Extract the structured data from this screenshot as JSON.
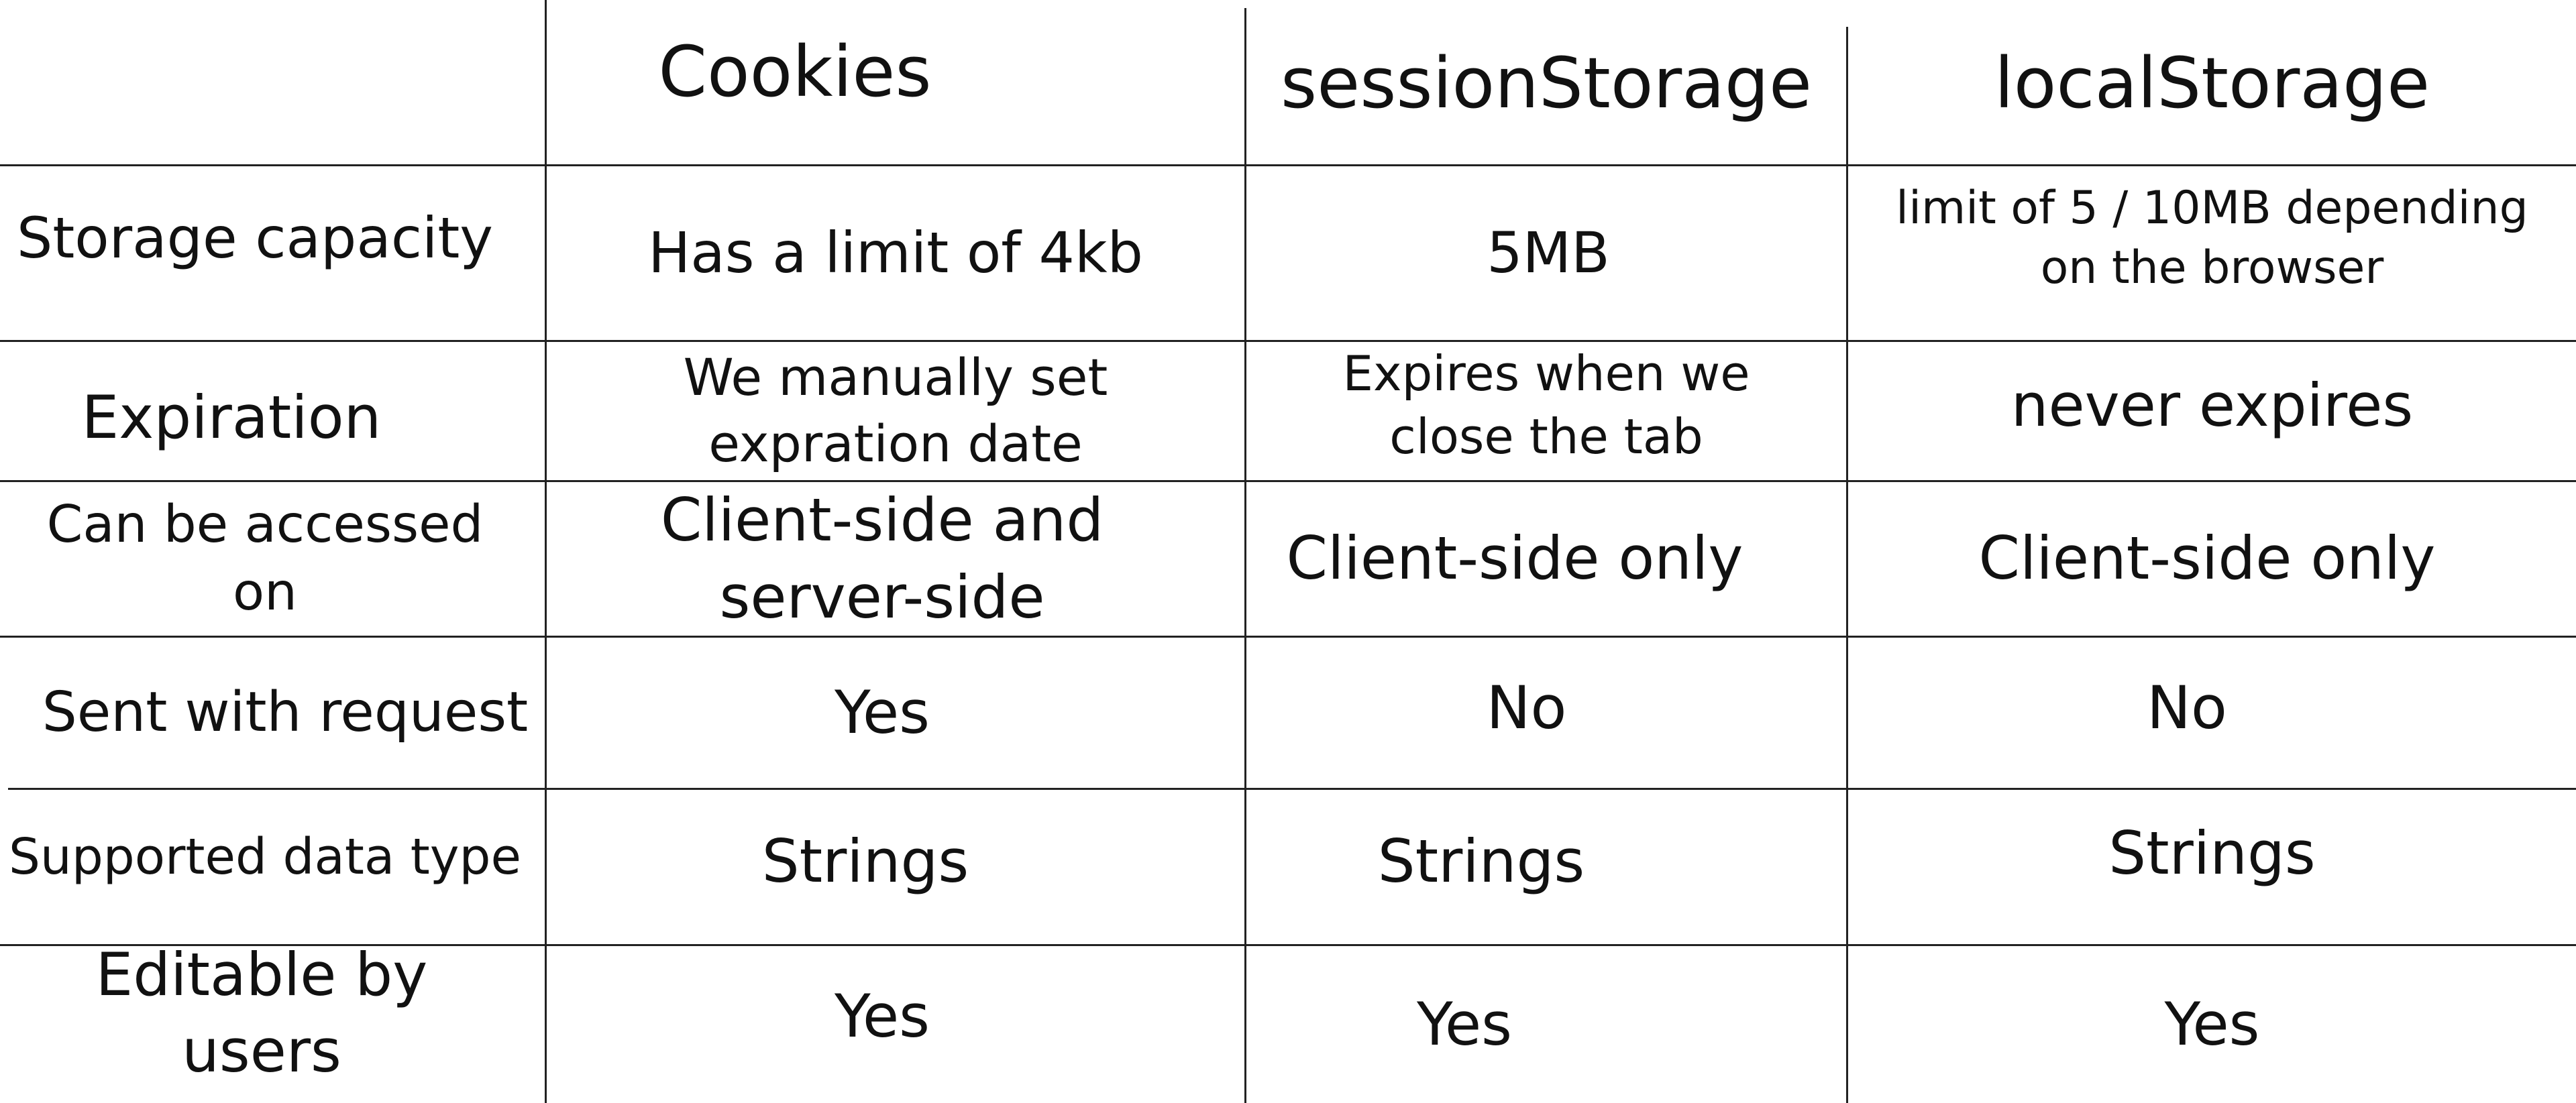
{
  "columns": [
    "Cookies",
    "sessionStorage",
    "localStorage"
  ],
  "rows": [
    {
      "label": "Storage capacity",
      "cookies": "Has a limit of 4kb",
      "session": "5MB",
      "local": "limit of 5 / 10MB depending on the browser"
    },
    {
      "label": "Expiration",
      "cookies": "We manually set expration date",
      "session": "Expires  when we close the tab",
      "local": "never expires"
    },
    {
      "label": "Can be accessed on",
      "cookies": "Client-side and server-side",
      "session": "Client-side only",
      "local": "Client-side only"
    },
    {
      "label": "Sent with request",
      "cookies": "Yes",
      "session": "No",
      "local": "No"
    },
    {
      "label": "Supported data type",
      "cookies": "Strings",
      "session": "Strings",
      "local": "Strings"
    },
    {
      "label": "Editable by users",
      "cookies": "Yes",
      "session": "Yes",
      "local": "Yes"
    }
  ],
  "colors": {
    "line": "#222222",
    "text": "#111111",
    "background": "#ffffff"
  }
}
